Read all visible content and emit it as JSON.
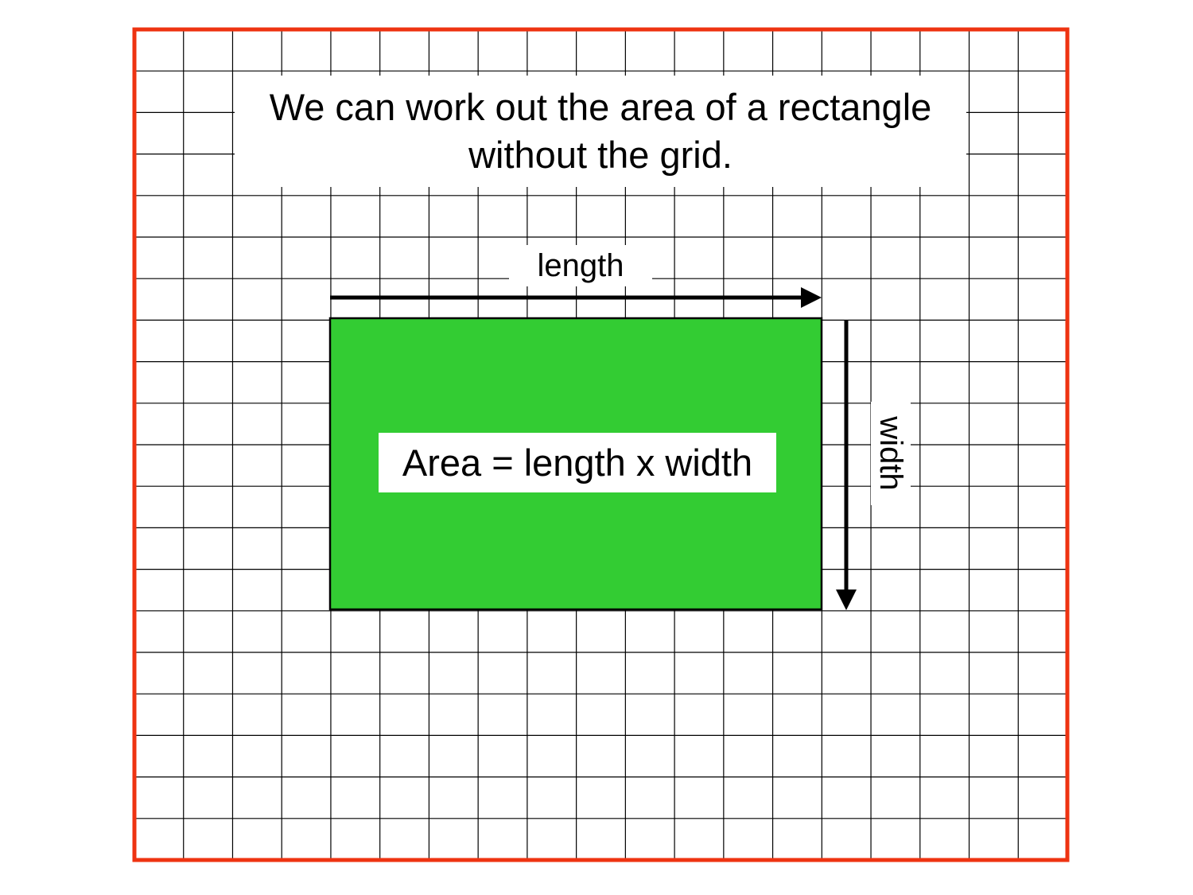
{
  "title": {
    "line1": "We can work out the area of a rectangle",
    "line2": "without the grid."
  },
  "labels": {
    "length": "length",
    "width": "width",
    "formula": "Area = length x width"
  },
  "grid": {
    "columns": 19,
    "rows": 20
  },
  "colors": {
    "border": "#ee3311",
    "rectangle_fill": "#33cc33",
    "grid_line": "#000000",
    "background": "#ffffff"
  }
}
